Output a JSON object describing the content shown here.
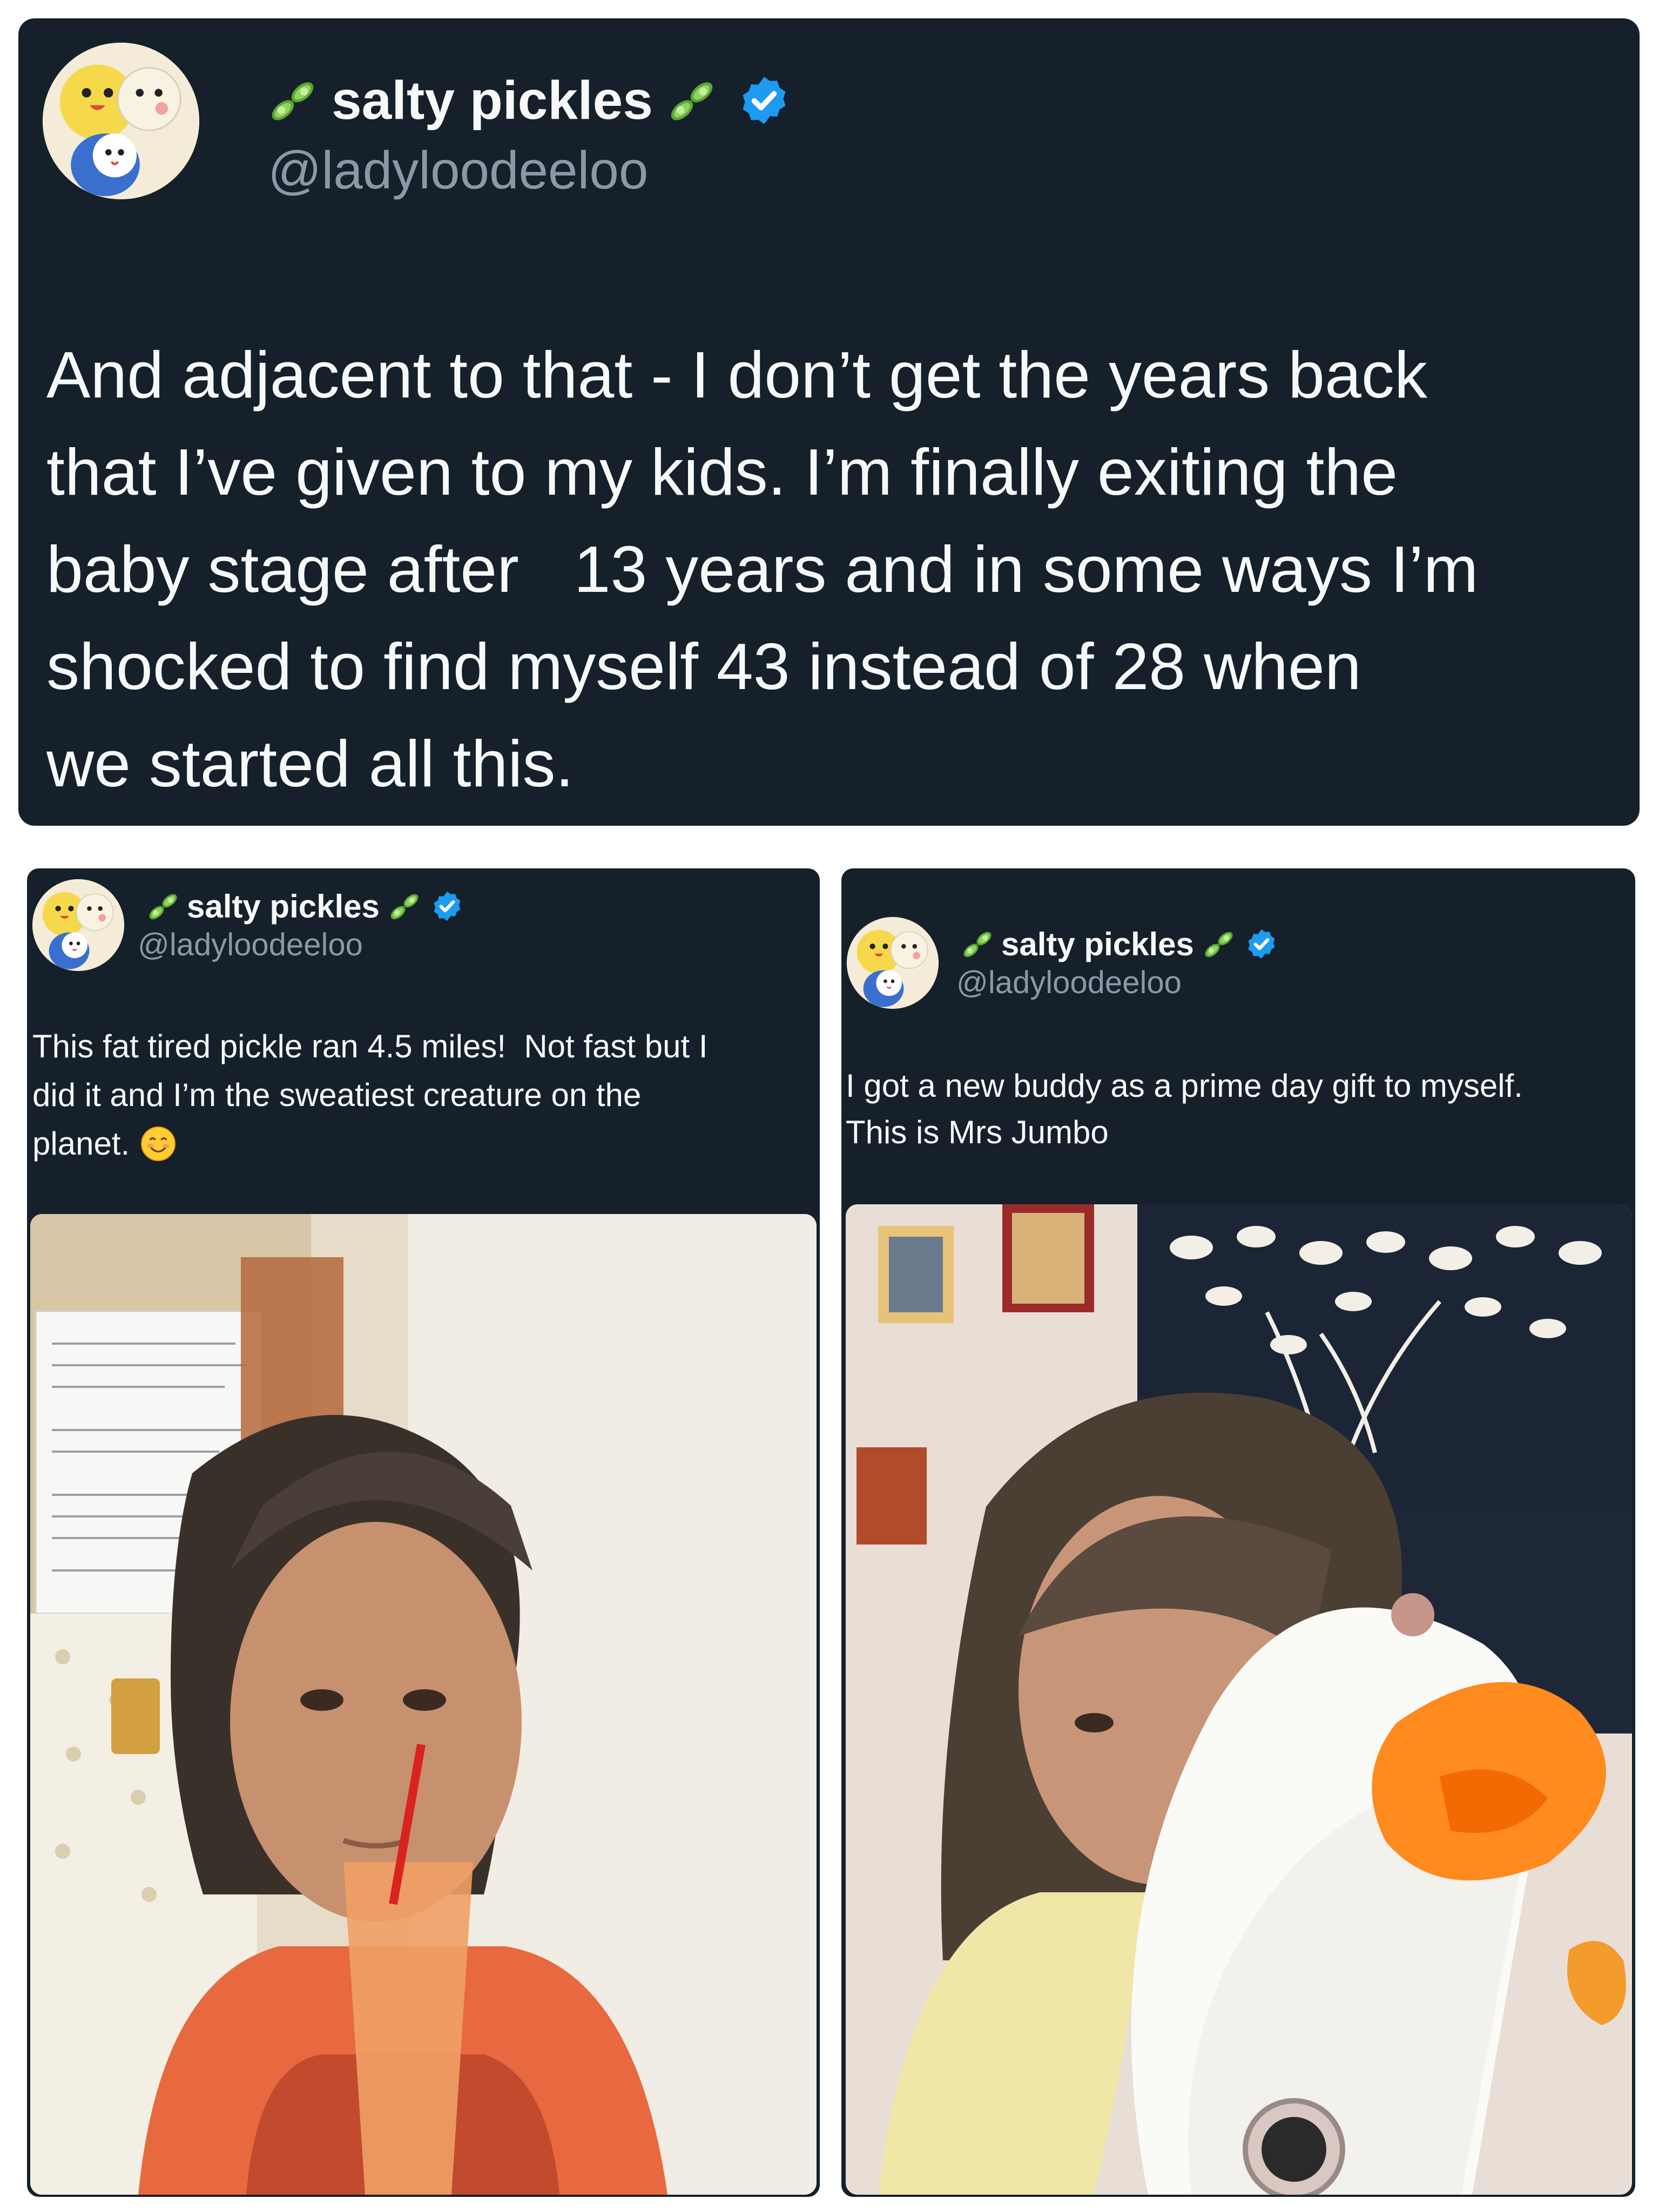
{
  "main_tweet": {
    "display_name": "salty pickles",
    "handle": "@ladyloodeeloo",
    "verified": true,
    "name_emoji": "cucumber-emoji",
    "text_lines": [
      "And adjacent to that - I don’t get the years back",
      "that I’ve given to my kids. I’m finally exiting the",
      "baby stage after   13 years and in some ways I’m",
      "shocked to find myself 43 instead of 28 when",
      "we started all this."
    ]
  },
  "left_tweet": {
    "display_name": "salty pickles",
    "handle": "@ladyloodeeloo",
    "verified": true,
    "name_emoji": "cucumber-emoji",
    "text_lines": [
      "This fat tired pickle ran 4.5 miles!  Not fast but I",
      "did it and I’m the sweatiest creature on the",
      "planet."
    ],
    "trailing_emoji": "smiling-face-emoji",
    "media": "selfie-photo-with-orange-cup"
  },
  "right_tweet": {
    "display_name": "salty pickles",
    "handle": "@ladyloodeeloo",
    "verified": true,
    "name_emoji": "cucumber-emoji",
    "text_lines": [
      "I got a new buddy as a prime day gift to myself.",
      "This is Mrs Jumbo"
    ],
    "media": "selfie-photo-with-plush-duck"
  },
  "colors": {
    "card_background": "#15202b",
    "text_primary": "#f7f9f9",
    "text_secondary": "#8b98a5",
    "verified_blue": "#1d9bf0",
    "page_background": "#ffffff"
  }
}
